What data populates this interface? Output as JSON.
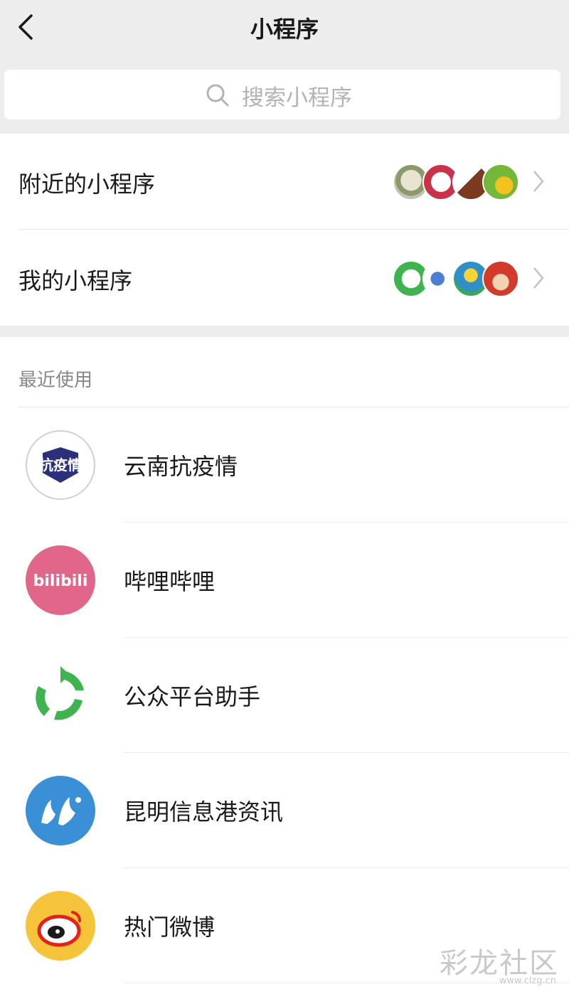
{
  "nav": {
    "title": "小程序"
  },
  "search": {
    "placeholder": "搜索小程序"
  },
  "nearby": {
    "label": "附近的小程序"
  },
  "mine": {
    "label": "我的小程序"
  },
  "recent": {
    "title": "最近使用",
    "items": [
      {
        "name": "云南抗疫情",
        "logo_text": "抗疫情",
        "icon": "yunnan-antivirus-logo"
      },
      {
        "name": "哔哩哔哩",
        "logo_text": "bilibili",
        "icon": "bilibili-logo"
      },
      {
        "name": "公众平台助手",
        "icon": "mp-assistant-logo"
      },
      {
        "name": "昆明信息港资讯",
        "icon": "kunming-info-logo"
      },
      {
        "name": "热门微博",
        "icon": "weibo-logo"
      }
    ]
  },
  "watermark": {
    "text": "彩龙社区",
    "url": "www.clzg.cn"
  },
  "colors": {
    "nav_bg": "#ededed",
    "bilibili": "#e0668a",
    "wechat_green": "#3fb34f",
    "kunming_blue": "#3a8fd6",
    "weibo_yellow": "#f5c43a"
  }
}
